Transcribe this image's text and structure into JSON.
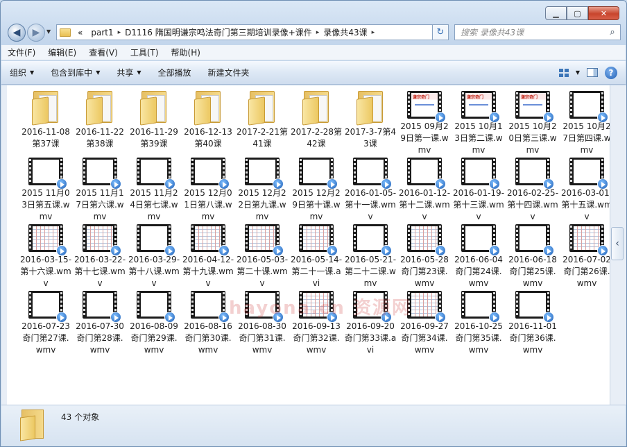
{
  "window": {
    "minimize_glyph": "▁",
    "maximize_glyph": "▢",
    "close_glyph": "✕"
  },
  "address": {
    "overflow": "«",
    "crumbs": [
      "part1",
      "D1116 隋国明谦宗鸣法奇门第三期培训录像+课件",
      "录像共43课"
    ],
    "separator": "▸"
  },
  "search": {
    "placeholder": "搜索 录像共43课"
  },
  "menu": [
    "文件(F)",
    "编辑(E)",
    "查看(V)",
    "工具(T)",
    "帮助(H)"
  ],
  "commands": {
    "organize": "组织",
    "include_library": "包含到库中",
    "share": "共享",
    "play_all": "全部播放",
    "new_folder": "新建文件夹"
  },
  "icons": {
    "back": "arrow-left-icon",
    "forward": "arrow-right-icon",
    "refresh": "refresh-icon",
    "search": "search-icon",
    "views": "views-icon",
    "preview_pane": "preview-pane-icon",
    "help": "help-icon"
  },
  "items": [
    {
      "name": "2016-11-08第37课",
      "type": "folder"
    },
    {
      "name": "2016-11-22第38课",
      "type": "folder"
    },
    {
      "name": "2016-11-29第39课",
      "type": "folder"
    },
    {
      "name": "2016-12-13第40课",
      "type": "folder"
    },
    {
      "name": "2017-2-21第41课",
      "type": "folder"
    },
    {
      "name": "2017-2-28第42课",
      "type": "folder"
    },
    {
      "name": "2017-3-7第43课",
      "type": "folder"
    },
    {
      "name": "2015 09月29日第一课.wmv",
      "type": "video",
      "frame": "ppt",
      "overlay": "谦宗奇门"
    },
    {
      "name": "2015 10月13日第二课.wmv",
      "type": "video",
      "frame": "ppt",
      "overlay": "谦宗奇门"
    },
    {
      "name": "2015 10月20日第三课.wmv",
      "type": "video",
      "frame": "ppt",
      "overlay": "谦宗奇门"
    },
    {
      "name": "2015 10月27日第四课.wmv",
      "type": "video",
      "frame": "blank"
    },
    {
      "name": "2015 11月03日第五课.wmv",
      "type": "video",
      "frame": "blank"
    },
    {
      "name": "2015 11月17日第六课.wmv",
      "type": "video",
      "frame": "blank"
    },
    {
      "name": "2015 11月24日第七课.wmv",
      "type": "video",
      "frame": "blank"
    },
    {
      "name": "2015 12月01日第八课.wmv",
      "type": "video",
      "frame": "blank"
    },
    {
      "name": "2015 12月22日第九课.wmv",
      "type": "video",
      "frame": "blank"
    },
    {
      "name": "2015 12月29日第十课.wmv",
      "type": "video",
      "frame": "blank"
    },
    {
      "name": "2016-01-05-第十一课.wmv",
      "type": "video",
      "frame": "blank"
    },
    {
      "name": "2016-01-12-第十二课.wmv",
      "type": "video",
      "frame": "blank"
    },
    {
      "name": "2016-01-19-第十三课.wmv",
      "type": "video",
      "frame": "blank"
    },
    {
      "name": "2016-02-25-第十四课.wmv",
      "type": "video",
      "frame": "blank"
    },
    {
      "name": "2016-03-01-第十五课.wmv",
      "type": "video",
      "frame": "blank"
    },
    {
      "name": "2016-03-15-第十六课.wmv",
      "type": "video",
      "frame": "table"
    },
    {
      "name": "2016-03-22-第十七课.wmv",
      "type": "video",
      "frame": "table"
    },
    {
      "name": "2016-03-29-第十八课.wmv",
      "type": "video",
      "frame": "blank"
    },
    {
      "name": "2016-04-12-第十九课.wmv",
      "type": "video",
      "frame": "table"
    },
    {
      "name": "2016-05-03-第二十课.wmv",
      "type": "video",
      "frame": "table"
    },
    {
      "name": "2016-05-14-第二十一课.avi",
      "type": "video",
      "frame": "table"
    },
    {
      "name": "2016-05-21-第二十二课.wmv",
      "type": "video",
      "frame": "blank"
    },
    {
      "name": "2016-05-28奇门第23课.wmv",
      "type": "video",
      "frame": "table"
    },
    {
      "name": "2016-06-04奇门第24课.wmv",
      "type": "video",
      "frame": "blank"
    },
    {
      "name": "2016-06-18奇门第25课.wmv",
      "type": "video",
      "frame": "blank"
    },
    {
      "name": "2016-07-02奇门第26课.wmv",
      "type": "video",
      "frame": "table"
    },
    {
      "name": "2016-07-23奇门第27课.wmv",
      "type": "video",
      "frame": "blank"
    },
    {
      "name": "2016-07-30奇门第28课.wmv",
      "type": "video",
      "frame": "blank"
    },
    {
      "name": "2016-08-09奇门第29课.wmv",
      "type": "video",
      "frame": "blank"
    },
    {
      "name": "2016-08-16奇门第30课.wmv",
      "type": "video",
      "frame": "blank"
    },
    {
      "name": "2016-08-30奇门第31课.wmv",
      "type": "video",
      "frame": "blank"
    },
    {
      "name": "2016-09-13奇门第32课.wmv",
      "type": "video",
      "frame": "table"
    },
    {
      "name": "2016-09-20奇门第33课.avi",
      "type": "video",
      "frame": "blank"
    },
    {
      "name": "2016-09-27奇门第34课.wmv",
      "type": "video",
      "frame": "table"
    },
    {
      "name": "2016-10-25奇门第35课.wmv",
      "type": "video",
      "frame": "blank"
    },
    {
      "name": "2016-11-01奇门第36课.wmv",
      "type": "video",
      "frame": "blank"
    }
  ],
  "watermark": "hayona.cn 资源网",
  "status": {
    "count_text": "43 个对象"
  },
  "colors": {
    "accent": "#3b75b8",
    "folder": "#ecc862",
    "close": "#c8452d"
  }
}
